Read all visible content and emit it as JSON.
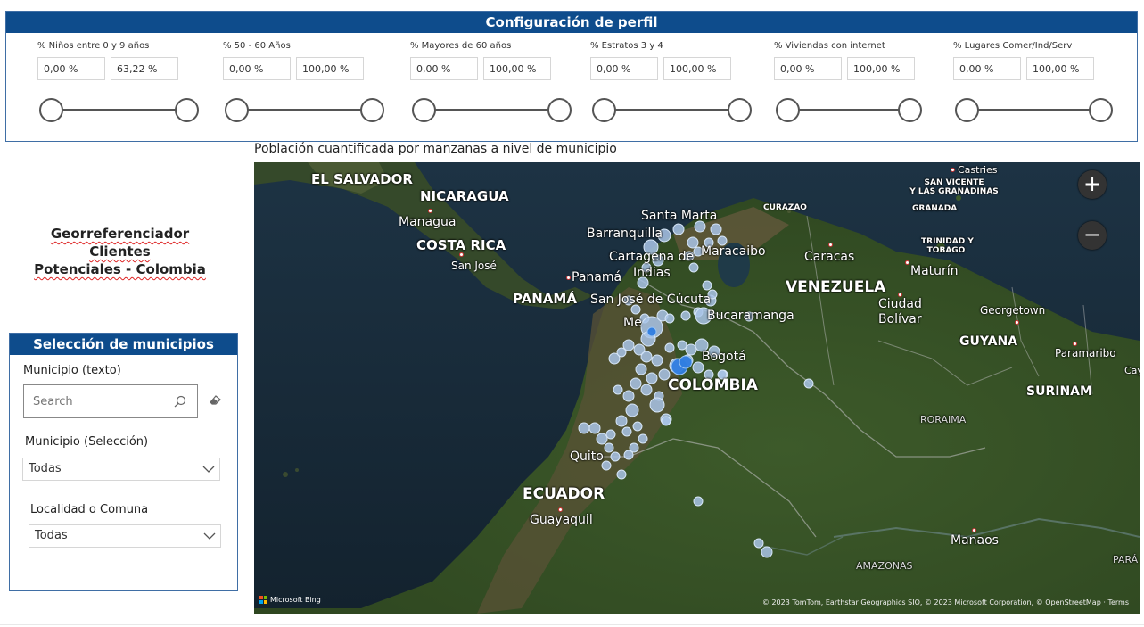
{
  "profile": {
    "title": "Configuración de perfil",
    "slicers": [
      {
        "label": "% Niños entre 0 y 9 años",
        "min": "0,00 %",
        "max": "63,22 %"
      },
      {
        "label": "% 50 - 60 Años",
        "min": "0,00 %",
        "max": "100,00 %"
      },
      {
        "label": "% Mayores de 60 años",
        "min": "0,00 %",
        "max": "100,00 %"
      },
      {
        "label": "% Estratos 3 y 4",
        "min": "0,00 %",
        "max": "100,00 %"
      },
      {
        "label": "% Viviendas con internet",
        "min": "0,00 %",
        "max": "100,00 %"
      },
      {
        "label": "% Lugares Comer/Ind/Serv",
        "min": "0,00 %",
        "max": "100,00 %"
      }
    ]
  },
  "app": {
    "title_line1": "Georreferenciador Clientes",
    "title_line2": "Potenciales - Colombia"
  },
  "municipios": {
    "title": "Selección de municipios",
    "text_label": "Municipio (texto)",
    "search_placeholder": "Search",
    "select_label": "Municipio (Selección)",
    "select_value": "Todas",
    "locality_label": "Localidad o Comuna",
    "locality_value": "Todas"
  },
  "map": {
    "title": "Población cuantificada por manzanas a nivel de municipio",
    "zoom_in": "+",
    "zoom_out": "−",
    "bing": "Microsoft Bing",
    "attribution_text": "© 2023 TomTom, Earthstar Geographics SIO, © 2023 Microsoft Corporation, ",
    "attribution_link": "© OpenStreetMap",
    "attribution_terms": "Terms",
    "labels": {
      "el_salvador": "EL SALVADOR",
      "nicaragua": "NICARAGUA",
      "managua": "Managua",
      "costa_rica": "COSTA RICA",
      "san_jose": "San José",
      "panama_country": "PANAMÁ",
      "panama_city": "Panamá",
      "santa_marta": "Santa Marta",
      "barranquilla": "Barranquilla",
      "cartagena": "Cartagena de",
      "indias": "Indias",
      "maracaibo": "Maracaibo",
      "caracas": "Caracas",
      "curazao": "CURAZAO",
      "castries": "Castries",
      "san_vicente": "SAN VICENTE",
      "granadinas": "Y LAS GRANADINAS",
      "granada": "GRANADA",
      "trinidad": "TRINIDAD Y",
      "tobago": "TOBAGO",
      "maturin": "Maturín",
      "venezuela": "VENEZUELA",
      "cucuta": "San José de Cúcuta",
      "bucaramanga": "Bucaramanga",
      "ciudad_bolivar1": "Ciudad",
      "ciudad_bolivar2": "Bolívar",
      "georgetown": "Georgetown",
      "guyana": "GUYANA",
      "paramaribo": "Paramaribo",
      "cayenne": "Caye",
      "medellin": "Me",
      "bogota": "Bogotá",
      "colombia": "COLOMBIA",
      "surinam": "SURINAM",
      "roraima": "RORAIMA",
      "quito": "Quito",
      "ecuador": "ECUADOR",
      "guayaquil": "Guayaquil",
      "manaos": "Manaos",
      "amazonas": "AMAZONAS",
      "para": "PARÁ"
    }
  }
}
